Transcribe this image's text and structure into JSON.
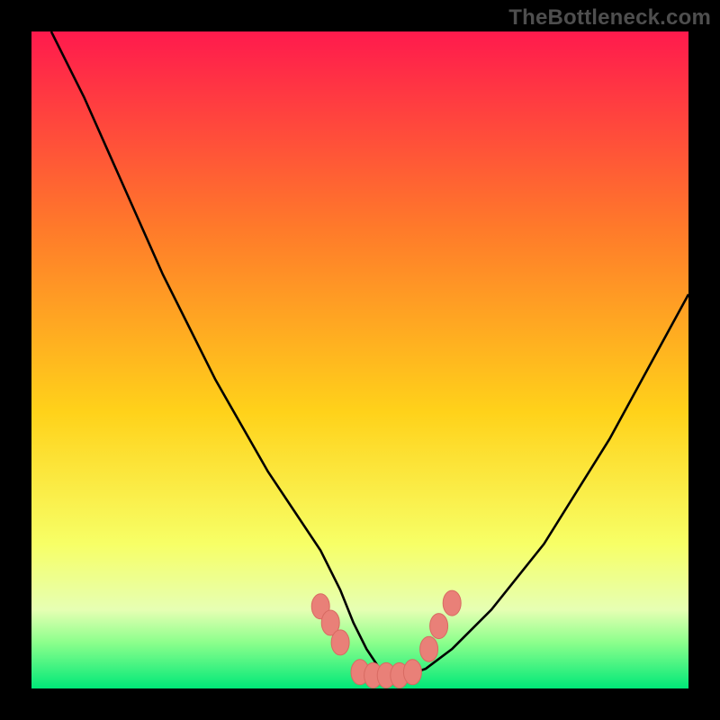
{
  "watermark": "TheBottleneck.com",
  "colors": {
    "bg": "#000000",
    "grad_top": "#ff1a4d",
    "grad_upper_mid": "#ff7a2a",
    "grad_mid": "#ffd21a",
    "grad_lower_mid": "#f7ff66",
    "grad_green_band_top": "#e6ffb3",
    "grad_green_band_mid": "#8cff8c",
    "grad_green_bottom": "#00e878",
    "curve": "#000000",
    "marker_fill": "#e98078",
    "marker_stroke": "#d86a62"
  },
  "chart_data": {
    "type": "line",
    "title": "",
    "xlabel": "",
    "ylabel": "",
    "xlim": [
      0,
      100
    ],
    "ylim": [
      0,
      100
    ],
    "grid": false,
    "legend": false,
    "series": [
      {
        "name": "bottleneck-curve",
        "x": [
          3,
          8,
          12,
          16,
          20,
          24,
          28,
          32,
          36,
          40,
          44,
          47,
          49,
          51,
          53,
          55,
          57,
          60,
          64,
          70,
          78,
          88,
          100
        ],
        "y": [
          100,
          90,
          81,
          72,
          63,
          55,
          47,
          40,
          33,
          27,
          21,
          15,
          10,
          6,
          3,
          2,
          2,
          3,
          6,
          12,
          22,
          38,
          60
        ]
      }
    ],
    "markers": [
      {
        "x": 44.0,
        "y_bottleneck": 12.5
      },
      {
        "x": 45.5,
        "y_bottleneck": 10.0
      },
      {
        "x": 47.0,
        "y_bottleneck": 7.0
      },
      {
        "x": 50.0,
        "y_bottleneck": 2.5
      },
      {
        "x": 52.0,
        "y_bottleneck": 2.0
      },
      {
        "x": 54.0,
        "y_bottleneck": 2.0
      },
      {
        "x": 56.0,
        "y_bottleneck": 2.0
      },
      {
        "x": 58.0,
        "y_bottleneck": 2.5
      },
      {
        "x": 60.5,
        "y_bottleneck": 6.0
      },
      {
        "x": 62.0,
        "y_bottleneck": 9.5
      },
      {
        "x": 64.0,
        "y_bottleneck": 13.0
      }
    ],
    "gradient_stops_pct": [
      {
        "offset": 0,
        "color_key": "grad_top"
      },
      {
        "offset": 30,
        "color_key": "grad_upper_mid"
      },
      {
        "offset": 58,
        "color_key": "grad_mid"
      },
      {
        "offset": 78,
        "color_key": "grad_lower_mid"
      },
      {
        "offset": 88,
        "color_key": "grad_green_band_top"
      },
      {
        "offset": 93,
        "color_key": "grad_green_band_mid"
      },
      {
        "offset": 100,
        "color_key": "grad_green_bottom"
      }
    ]
  }
}
